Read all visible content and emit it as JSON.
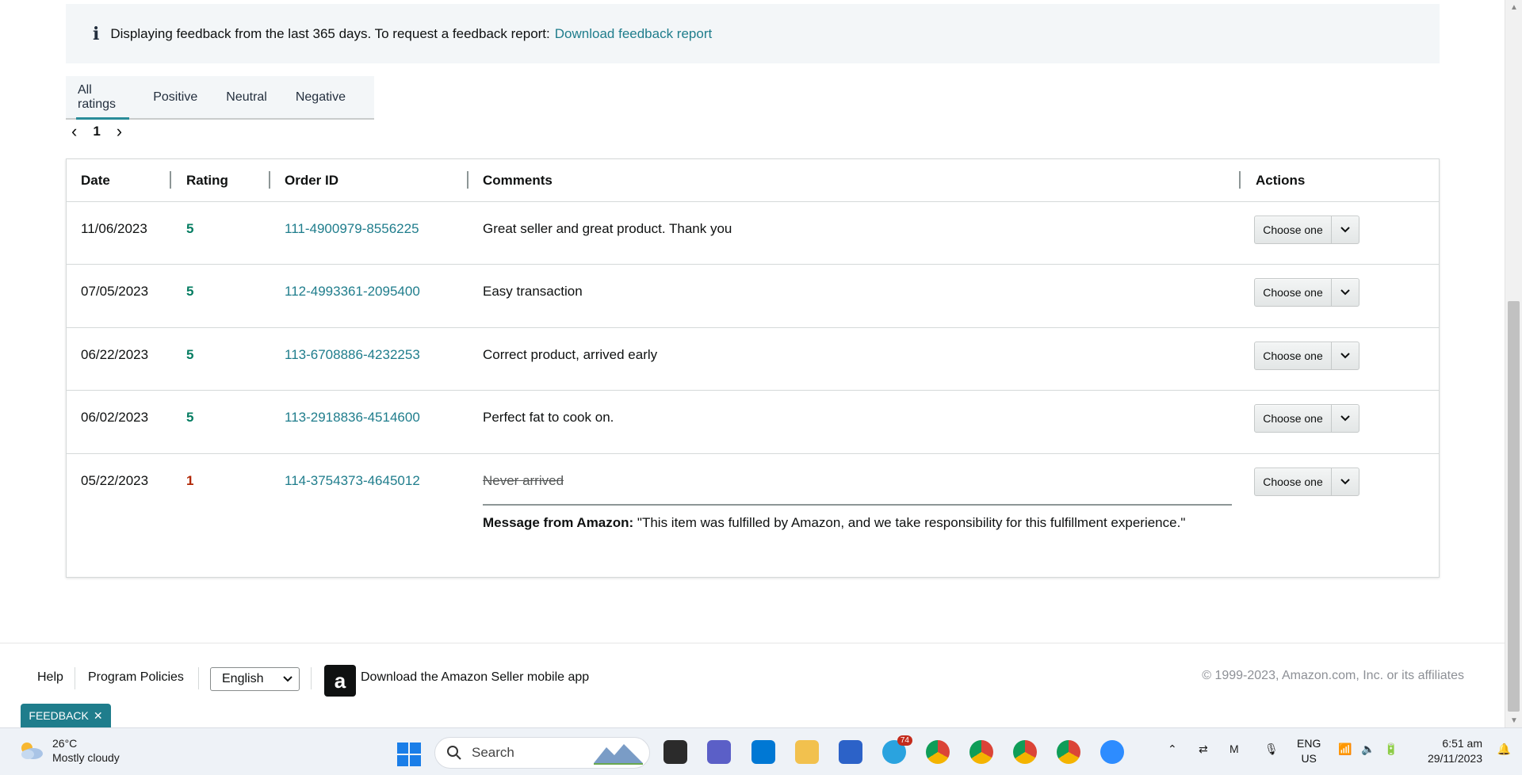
{
  "banner": {
    "text": "Displaying feedback from the last 365 days. To request a feedback report:",
    "link": "Download feedback report"
  },
  "tabs": [
    {
      "label": "All ratings",
      "active": true
    },
    {
      "label": "Positive"
    },
    {
      "label": "Neutral"
    },
    {
      "label": "Negative"
    }
  ],
  "pager": {
    "page": "1"
  },
  "table": {
    "headers": {
      "date": "Date",
      "rating": "Rating",
      "order_id": "Order ID",
      "comments": "Comments",
      "actions": "Actions"
    },
    "rows": [
      {
        "date": "11/06/2023",
        "rating": "5",
        "order_id": "111-4900979-8556225",
        "comment": "Great seller and great product. Thank you",
        "action": "Choose one"
      },
      {
        "date": "07/05/2023",
        "rating": "5",
        "order_id": "112-4993361-2095400",
        "comment": "Easy transaction",
        "action": "Choose one"
      },
      {
        "date": "06/22/2023",
        "rating": "5",
        "order_id": "113-6708886-4232253",
        "comment": "Correct product, arrived early",
        "action": "Choose one"
      },
      {
        "date": "06/02/2023",
        "rating": "5",
        "order_id": "113-2918836-4514600",
        "comment": "Perfect fat to cook on.",
        "action": "Choose one"
      },
      {
        "date": "05/22/2023",
        "rating": "1",
        "order_id": "114-3754373-4645012",
        "comment": "Never arrived",
        "action": "Choose one",
        "amazon_message_label": "Message from Amazon:",
        "amazon_message": "\"This item was fulfilled by Amazon, and we take responsibility for this fulfillment experience.\""
      }
    ]
  },
  "footer": {
    "help": "Help",
    "policies": "Program Policies",
    "language": "English",
    "app": "Download the Amazon Seller mobile app",
    "copyright": "© 1999-2023, Amazon.com, Inc. or its affiliates"
  },
  "feedback_chip": "FEEDBACK",
  "taskbar": {
    "weather_temp": "26°C",
    "weather_desc": "Mostly cloudy",
    "search_placeholder": "Search",
    "telegram_badge": "74",
    "lang_line1": "ENG",
    "lang_line2": "US",
    "time": "6:51 am",
    "date": "29/11/2023"
  },
  "colors": {
    "link": "#1f7d8c",
    "positive": "#067d62",
    "negative": "#b12704",
    "tab_accent": "#2a8c99"
  }
}
